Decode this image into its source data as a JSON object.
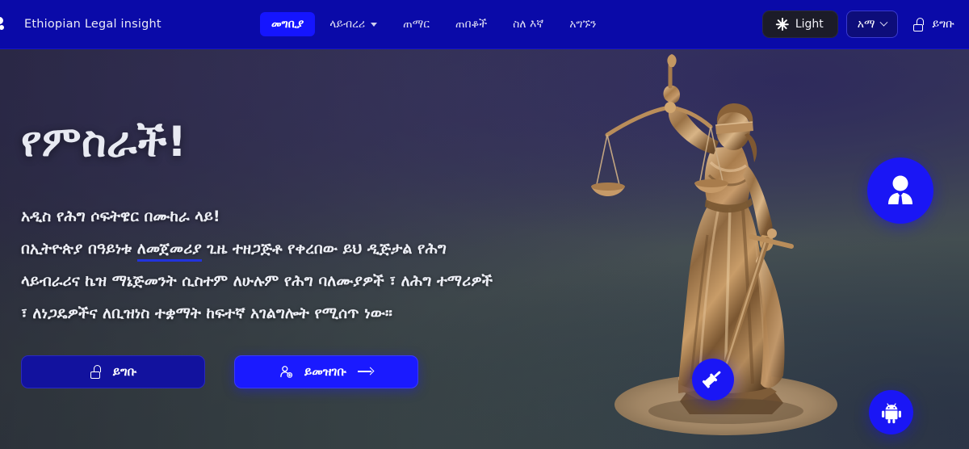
{
  "brand": {
    "name": "Ethiopian Legal insight",
    "logo_icon": "dots-logo-icon"
  },
  "nav": {
    "items": [
      {
        "label": "መግቢያ",
        "active": true,
        "has_dropdown": false,
        "name": "nav-item-home"
      },
      {
        "label": "ላይብረሪ",
        "active": false,
        "has_dropdown": true,
        "name": "nav-item-library"
      },
      {
        "label": "ጠማር",
        "active": false,
        "has_dropdown": false,
        "name": "nav-item-temar"
      },
      {
        "label": "ጠበቆች",
        "active": false,
        "has_dropdown": false,
        "name": "nav-item-lawyers"
      },
      {
        "label": "ስለ እኛ",
        "active": false,
        "has_dropdown": false,
        "name": "nav-item-about"
      },
      {
        "label": "አግኙን",
        "active": false,
        "has_dropdown": false,
        "name": "nav-item-contact"
      }
    ],
    "theme_toggle": {
      "label": "Light",
      "icon": "sun-icon"
    },
    "language": {
      "value": "አማ",
      "icon": "chevron-down-icon"
    },
    "login": {
      "label": "ይግቡ",
      "icon": "unlock-icon"
    }
  },
  "hero": {
    "title": "የምስራች!",
    "lines": [
      {
        "text": "አዲስ የሕግ ሶፍትዌር በሙከራ ላይ!",
        "underline": null
      },
      {
        "pre": "በኢትዮጵያ በዓይነቱ ",
        "underline": "ለመጀመሪያ",
        "post": " ጊዜ ተዘጋጅቶ የቀረበው ይህ ዲጅታል የሕግ"
      },
      {
        "text": "ላይብራሪና ኬዝ ማኔጅመንት ሲስተም ለሁሉም የሕግ ባለሙያዎች ፣ ለሕግ ተማሪዎች",
        "underline": null
      },
      {
        "text": "፣ ለነጋዴዎችና ለቢዝነስ ተቋማት ከፍተኛ አገልግሎት የሚሰጥ ነው።",
        "underline": null
      }
    ],
    "cta": {
      "login": {
        "label": "ይግቡ",
        "icon": "unlock-icon"
      },
      "register": {
        "label": "ይመዝገቡ",
        "icon": "user-plus-icon",
        "trailing_icon": "arrow-right-icon"
      }
    },
    "badges": [
      {
        "name": "badge-person",
        "icon": "business-person-icon"
      },
      {
        "name": "badge-gavel",
        "icon": "gavel-icon"
      },
      {
        "name": "badge-android",
        "icon": "android-icon"
      }
    ],
    "illustration": "lady-justice-statue"
  },
  "colors": {
    "nav_bg": "#0a0aa8",
    "accent_blue": "#1a1aff",
    "badge_blue": "#1a16f5",
    "underline": "#2233dd",
    "text_light": "#eceef5",
    "bronze": "#9a6f3f"
  }
}
